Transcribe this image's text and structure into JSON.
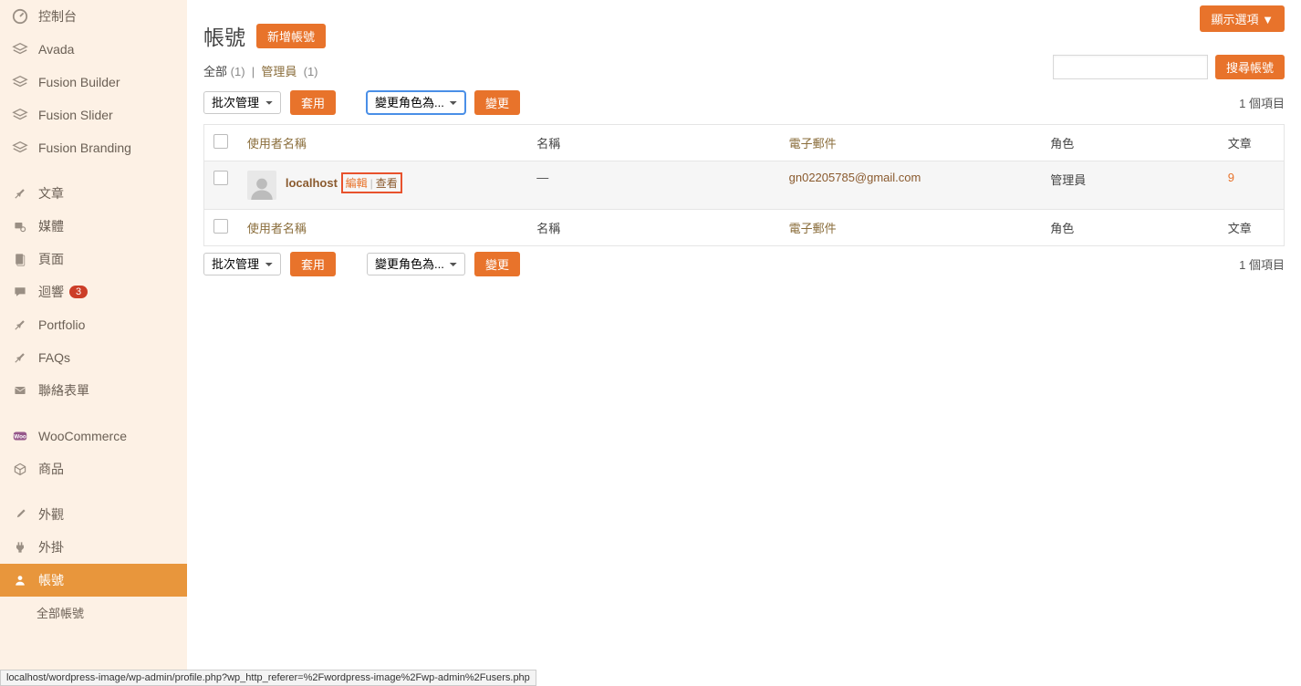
{
  "sidebar": {
    "items": [
      {
        "icon": "gauge",
        "label": "控制台"
      },
      {
        "icon": "layers",
        "label": "Avada"
      },
      {
        "icon": "layers",
        "label": "Fusion Builder"
      },
      {
        "icon": "layers",
        "label": "Fusion Slider"
      },
      {
        "icon": "layers",
        "label": "Fusion Branding"
      },
      {
        "icon": "pin",
        "label": "文章"
      },
      {
        "icon": "media",
        "label": "媒體"
      },
      {
        "icon": "page",
        "label": "頁面"
      },
      {
        "icon": "comment",
        "label": "迴響",
        "badge": "3"
      },
      {
        "icon": "pin",
        "label": "Portfolio"
      },
      {
        "icon": "pin",
        "label": "FAQs"
      },
      {
        "icon": "mail",
        "label": "聯絡表單"
      },
      {
        "icon": "woo",
        "label": "WooCommerce"
      },
      {
        "icon": "cube",
        "label": "商品"
      },
      {
        "icon": "brush",
        "label": "外觀"
      },
      {
        "icon": "plug",
        "label": "外掛"
      },
      {
        "icon": "user",
        "label": "帳號",
        "active": true
      }
    ],
    "submenu": [
      {
        "label": "全部帳號"
      }
    ]
  },
  "screen_options": "顯示選項",
  "page": {
    "title": "帳號",
    "add_new": "新增帳號"
  },
  "filters": {
    "all": "全部",
    "all_count": "(1)",
    "admin": "管理員",
    "admin_count": "(1)"
  },
  "search": {
    "placeholder": "",
    "button": "搜尋帳號"
  },
  "bulk": {
    "select": "批次管理",
    "apply": "套用",
    "role_select": "變更角色為...",
    "change": "變更"
  },
  "item_count": "1 個項目",
  "table": {
    "cols": {
      "username": "使用者名稱",
      "name": "名稱",
      "email": "電子郵件",
      "role": "角色",
      "posts": "文章"
    },
    "rows": [
      {
        "username": "localhost",
        "name": "—",
        "email": "gn02205785@gmail.com",
        "role": "管理員",
        "posts": "9",
        "actions": {
          "edit": "編輯",
          "view": "查看"
        }
      }
    ]
  },
  "status_url": "localhost/wordpress-image/wp-admin/profile.php?wp_http_referer=%2Fwordpress-image%2Fwp-admin%2Fusers.php"
}
